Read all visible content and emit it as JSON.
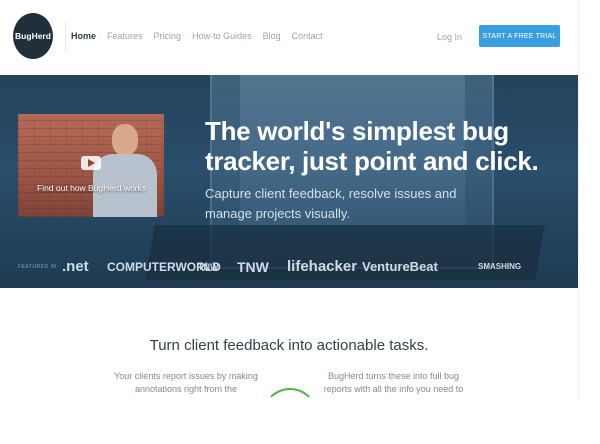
{
  "header": {
    "logo_text": "BugHerd",
    "nav": [
      {
        "label": "Home",
        "active": true
      },
      {
        "label": "Features",
        "active": false
      },
      {
        "label": "Pricing",
        "active": false
      },
      {
        "label": "How-to Guides",
        "active": false
      },
      {
        "label": "Blog",
        "active": false
      },
      {
        "label": "Contact",
        "active": false
      }
    ],
    "login_label": "Log In",
    "cta_label": "START A FREE TRIAL"
  },
  "hero": {
    "video_caption": "Find out how BugHerd works",
    "headline": "The world's simplest bug tracker, just point and click.",
    "subline": "Capture client feedback, resolve issues and manage projects visually.",
    "featured_label": "FEATURED IN",
    "publications": [
      ".net",
      "COMPUTERWORLD",
      "TNW",
      "TNW",
      "lifehacker",
      "VentureBeat",
      "SMASHING"
    ]
  },
  "section": {
    "tagline": "Turn client feedback into actionable tasks.",
    "left_text": "Your clients report issues by making annotations right from the",
    "right_text": "BugHerd turns these into full bug reports with all the info you need to"
  },
  "colors": {
    "accent": "#3a9fe0",
    "hero_bg": "#24435d",
    "logo_bg": "#1f2f3c",
    "arrow": "#4ab84a"
  }
}
